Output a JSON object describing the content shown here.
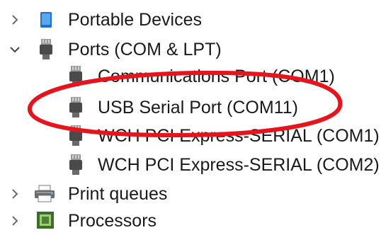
{
  "tree": {
    "items": [
      {
        "label": "Portable Devices",
        "expanded": false,
        "icon": "portable-device-icon"
      },
      {
        "label": "Ports (COM & LPT)",
        "expanded": true,
        "icon": "port-connector-icon",
        "children": [
          {
            "label": "Communications Port (COM1)",
            "icon": "port-connector-icon"
          },
          {
            "label": "USB Serial Port (COM11)",
            "icon": "port-connector-icon"
          },
          {
            "label": "WCH PCI Express-SERIAL (COM1)",
            "icon": "port-connector-icon"
          },
          {
            "label": "WCH PCI Express-SERIAL (COM2)",
            "icon": "port-connector-icon"
          }
        ]
      },
      {
        "label": "Print queues",
        "expanded": false,
        "icon": "printer-icon"
      },
      {
        "label": "Processors",
        "expanded": false,
        "icon": "processor-chip-icon"
      }
    ]
  },
  "annotation": {
    "type": "ellipse",
    "color": "#e8141c",
    "target": "USB Serial Port (COM11)"
  }
}
